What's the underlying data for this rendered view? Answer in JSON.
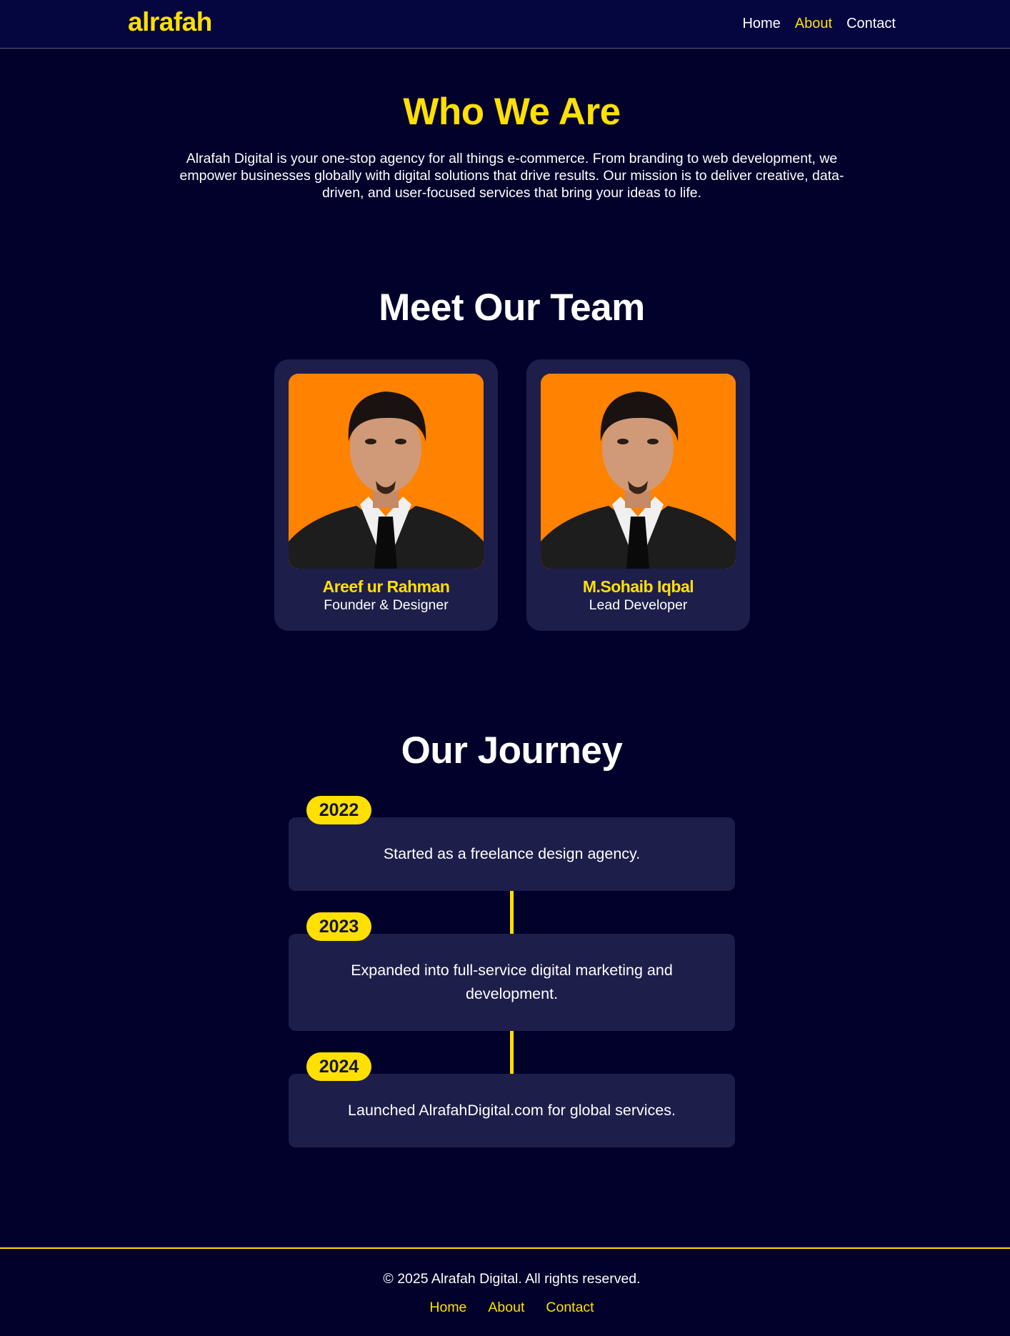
{
  "header": {
    "logo": "alrafah",
    "nav": [
      {
        "label": "Home",
        "active": false
      },
      {
        "label": "About",
        "active": true
      },
      {
        "label": "Contact",
        "active": false
      }
    ]
  },
  "who": {
    "title": "Who We Are",
    "text": "Alrafah Digital is your one-stop agency for all things e-commerce. From branding to web development, we empower businesses globally with digital solutions that drive results. Our mission is to deliver creative, data-driven, and user-focused services that bring your ideas to life."
  },
  "team": {
    "title": "Meet Our Team",
    "members": [
      {
        "name": "Areef ur Rahman",
        "role": "Founder & Designer"
      },
      {
        "name": "M.Sohaib Iqbal",
        "role": "Lead Developer"
      }
    ]
  },
  "journey": {
    "title": "Our Journey",
    "events": [
      {
        "year": "2022",
        "text": "Started as a freelance design agency."
      },
      {
        "year": "2023",
        "text": "Expanded into full-service digital marketing and development."
      },
      {
        "year": "2024",
        "text": "Launched AlrafahDigital.com for global services."
      }
    ]
  },
  "footer": {
    "copyright": "© 2025 Alrafah Digital. All rights reserved.",
    "links": [
      "Home",
      "About",
      "Contact"
    ]
  },
  "colors": {
    "background": "#01012b",
    "header": "#050540",
    "card": "#1e1e4b",
    "accent": "#ffe000",
    "photo_bg": "#ff8200"
  }
}
